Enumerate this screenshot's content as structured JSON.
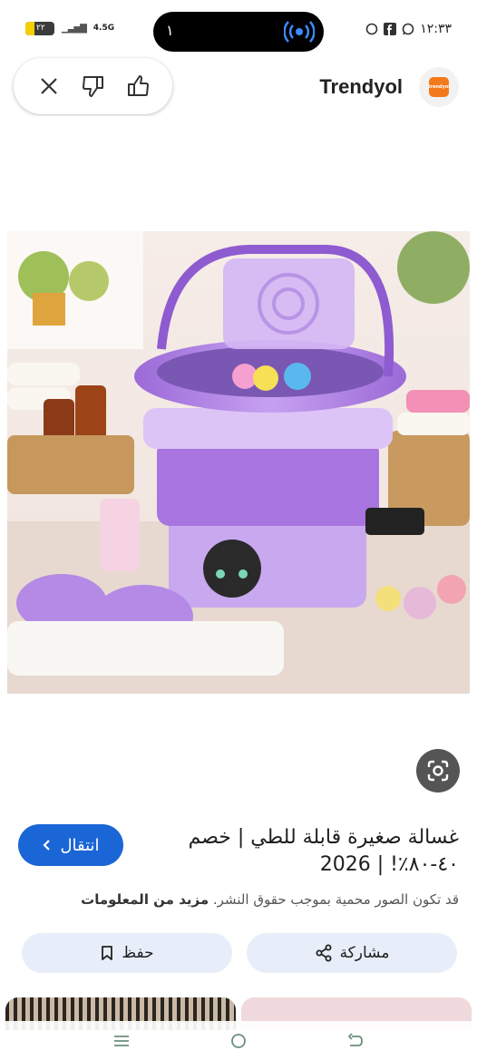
{
  "status_bar": {
    "battery": "٢٢",
    "network": "4.5G",
    "island_number": "١",
    "time": "١٢:٣٣"
  },
  "header": {
    "brand_name": "Trendyol",
    "logo_text": "trendyol"
  },
  "info": {
    "visit_label": "انتقال",
    "title": "غسالة صغيرة قابلة للطي | خصم ٤٠-٨٠٪! | 2026",
    "rights_text": "قد تكون الصور محمية بموجب حقوق النشر.",
    "more_info": "مزيد من المعلومات",
    "share_label": "مشاركة",
    "save_label": "حفظ"
  },
  "colors": {
    "primary_blue": "#1a66d6",
    "button_bg": "#e8eef9",
    "washer_purple": "#b78be6",
    "brand_orange": "#f27a1a"
  },
  "icons": [
    "close-icon",
    "thumbs-down-icon",
    "thumbs-up-icon",
    "google-lens-icon",
    "share-icon",
    "bookmark-icon",
    "chevron-left-icon",
    "menu-icon",
    "home-icon",
    "back-icon"
  ]
}
